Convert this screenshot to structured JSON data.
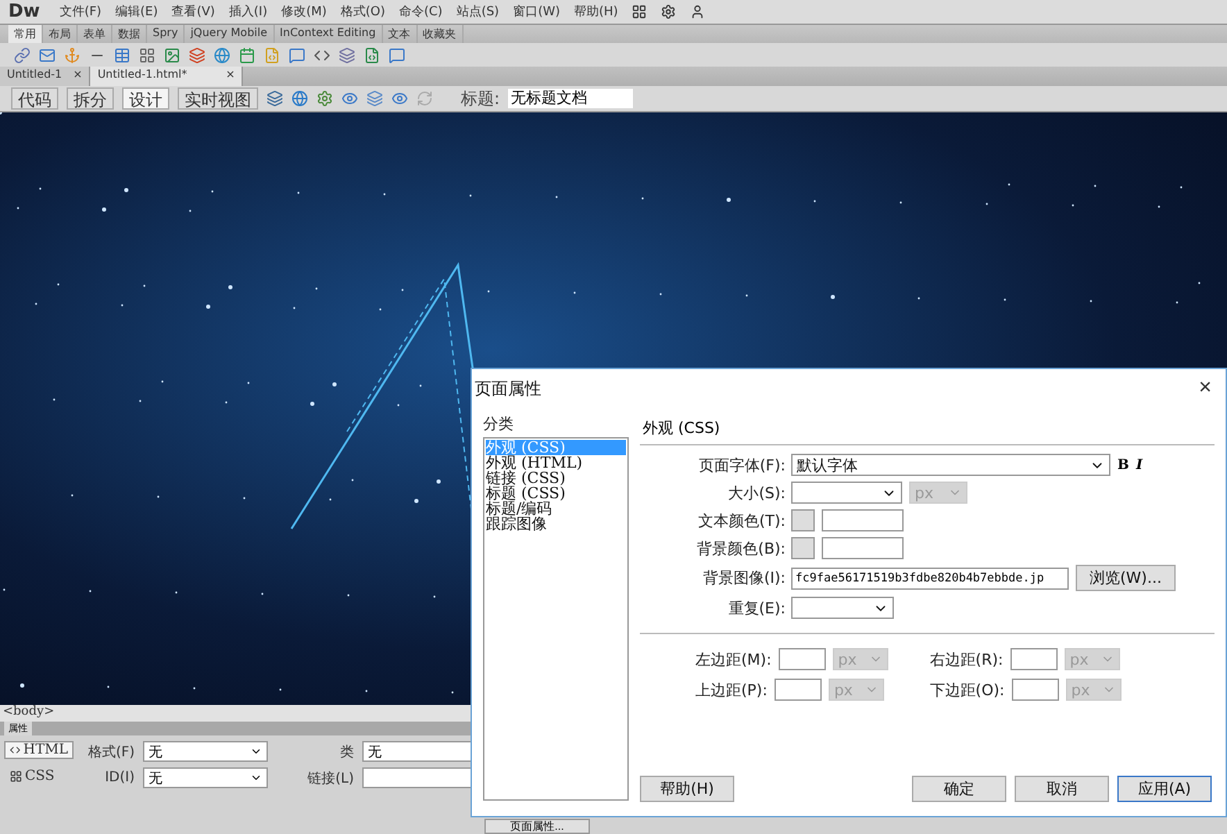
{
  "app": {
    "logo": "Dw",
    "menus": [
      "文件(F)",
      "编辑(E)",
      "查看(V)",
      "插入(I)",
      "修改(M)",
      "格式(O)",
      "命令(C)",
      "站点(S)",
      "窗口(W)",
      "帮助(H)"
    ]
  },
  "insert_tabs": [
    {
      "label": "常用",
      "selected": true
    },
    {
      "label": "布局",
      "selected": false
    },
    {
      "label": "表单",
      "selected": false
    },
    {
      "label": "数据",
      "selected": false
    },
    {
      "label": "Spry",
      "selected": false
    },
    {
      "label": "jQuery Mobile",
      "selected": false
    },
    {
      "label": "InContext Editing",
      "selected": false
    },
    {
      "label": "文本",
      "selected": false
    },
    {
      "label": "收藏夹",
      "selected": false
    }
  ],
  "doc_tabs": [
    {
      "label": "Untitled-1",
      "close": "×",
      "selected": false
    },
    {
      "label": "Untitled-1.html*",
      "close": "×",
      "selected": true
    }
  ],
  "view_buttons": [
    {
      "label": "代码",
      "selected": false
    },
    {
      "label": "拆分",
      "selected": false
    },
    {
      "label": "设计",
      "selected": true
    },
    {
      "label": "实时视图",
      "selected": false
    }
  ],
  "title_field": {
    "label": "标题:",
    "value": "无标题文档"
  },
  "tag_selector": "<body>",
  "properties": {
    "tab": "属性",
    "modes": [
      {
        "label": "HTML",
        "selected": true
      },
      {
        "label": "CSS",
        "selected": false
      }
    ],
    "rows": [
      {
        "label": "格式(F)",
        "value": "无",
        "label2": "类",
        "value2": "无"
      },
      {
        "label": "ID(I)",
        "value": "无",
        "label2": "链接(L)",
        "value2": ""
      }
    ],
    "bottom_button": "页面属性..."
  },
  "dialog": {
    "title": "页面属性",
    "close": "×",
    "category_label": "分类",
    "categories": [
      {
        "label": "外观 (CSS)",
        "selected": true
      },
      {
        "label": "外观 (HTML)",
        "selected": false
      },
      {
        "label": "链接 (CSS)",
        "selected": false
      },
      {
        "label": "标题 (CSS)",
        "selected": false
      },
      {
        "label": "标题/编码",
        "selected": false
      },
      {
        "label": "跟踪图像",
        "selected": false
      }
    ],
    "section": "外观 (CSS)",
    "font": {
      "label": "页面字体(F):",
      "value": "默认字体",
      "bold": "B",
      "italic": "I"
    },
    "size": {
      "label": "大小(S):",
      "unit": "px"
    },
    "text_color": {
      "label": "文本颜色(T):"
    },
    "bg_color": {
      "label": "背景颜色(B):"
    },
    "bg_image": {
      "label": "背景图像(I):",
      "value": "fc9fae56171519b3fdbe820b4b7ebbde.jp",
      "browse": "浏览(W)..."
    },
    "repeat": {
      "label": "重复(E):"
    },
    "margins": [
      {
        "label": "左边距(M):",
        "unit": "px"
      },
      {
        "label": "右边距(R):",
        "unit": "px"
      },
      {
        "label": "上边距(P):",
        "unit": "px"
      },
      {
        "label": "下边距(O):",
        "unit": "px"
      }
    ],
    "buttons": [
      {
        "kind": "help",
        "label": "帮助(H)"
      },
      {
        "kind": "ok",
        "label": "确定"
      },
      {
        "kind": "cancel",
        "label": "取消"
      },
      {
        "kind": "apply",
        "label": "应用(A)"
      }
    ]
  }
}
